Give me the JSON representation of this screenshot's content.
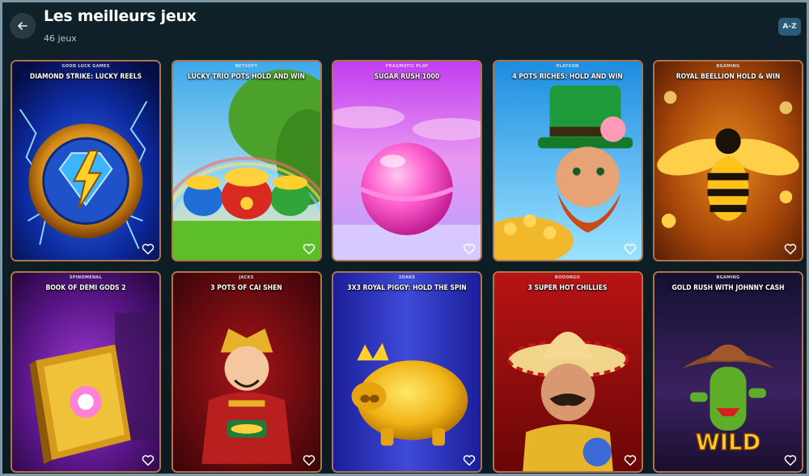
{
  "header": {
    "title": "Les meilleurs jeux",
    "count_label": "46 jeux",
    "sort_label": "A-Z"
  },
  "games": [
    {
      "provider": "GOOD LUCK GAMES",
      "title": "DIAMOND STRIKE: LUCKY REELS",
      "art": "lightning-diamond"
    },
    {
      "provider": "BETSOFT",
      "title": "LUCKY TRIO POTS HOLD AND WIN",
      "art": "gold-pots"
    },
    {
      "provider": "PRAGMATIC PLAY",
      "title": "SUGAR RUSH 1000",
      "art": "candy-ball"
    },
    {
      "provider": "PLAYSON",
      "title": "4 POTS RICHES: HOLD AND WIN",
      "art": "leprechaun"
    },
    {
      "provider": "BGAMING",
      "title": "ROYAL BEELLION HOLD & WIN",
      "art": "golden-bee"
    },
    {
      "provider": "SPINOMENAL",
      "title": "BOOK OF DEMI GODS 2",
      "art": "golden-book"
    },
    {
      "provider": "JACKS",
      "title": "3 POTS OF CAI SHEN",
      "art": "cai-shen"
    },
    {
      "provider": "3OAKS",
      "title": "3X3 ROYAL PIGGY: HOLD THE SPIN",
      "art": "golden-piggy"
    },
    {
      "provider": "BOOONGO",
      "title": "3 SUPER HOT CHILLIES",
      "art": "mariachi"
    },
    {
      "provider": "BGAMING",
      "title": "GOLD RUSH WITH JOHNNY CASH",
      "art": "cactus-wild"
    }
  ],
  "wild_text": "WILD",
  "colors": {
    "card_border": "#b0744a",
    "background": "#0d1b22",
    "sort_button": "#2b5b78"
  }
}
